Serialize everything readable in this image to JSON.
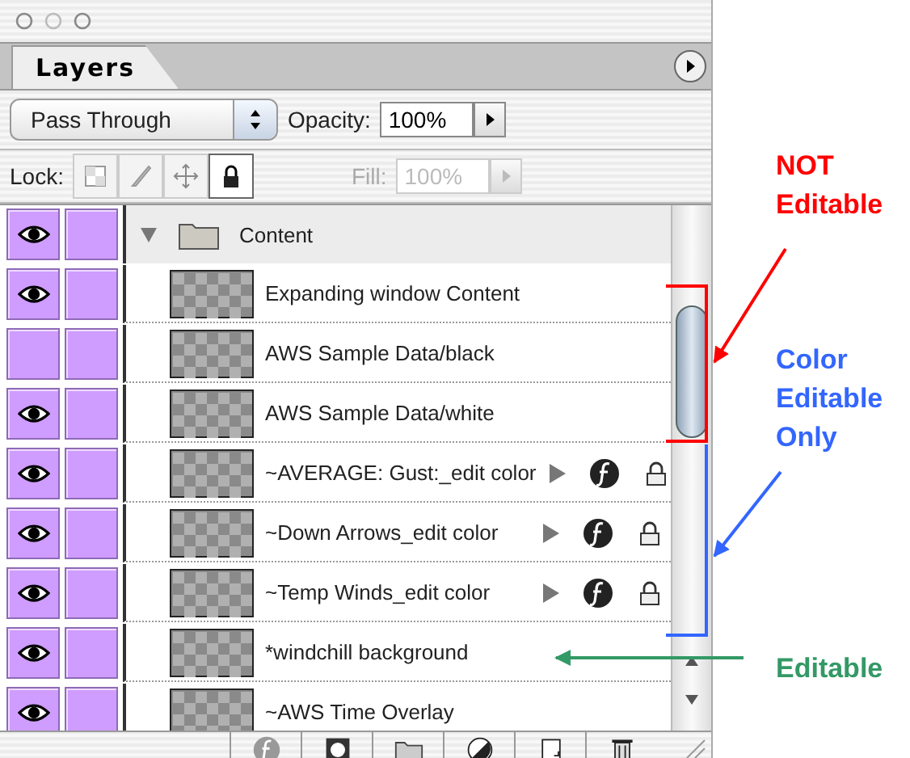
{
  "tabs": [
    {
      "label": "Layers",
      "selected": true
    }
  ],
  "blend_mode": {
    "value": "Pass Through"
  },
  "opacity": {
    "label": "Opacity:",
    "value": "100%"
  },
  "lock": {
    "label": "Lock:",
    "options": [
      {
        "kind": "transparency",
        "on": false
      },
      {
        "kind": "brush",
        "on": false
      },
      {
        "kind": "move",
        "on": false
      },
      {
        "kind": "all",
        "on": true
      }
    ]
  },
  "fill": {
    "label": "Fill:",
    "value": "100%",
    "disabled": true
  },
  "group": {
    "name": "Content",
    "expanded": true,
    "visible": true
  },
  "layers": [
    {
      "name": "Expanding window Content",
      "visible": true,
      "effects": false,
      "locked": false
    },
    {
      "name": "AWS Sample Data/black",
      "visible": false,
      "effects": false,
      "locked": false
    },
    {
      "name": "AWS Sample Data/white",
      "visible": true,
      "effects": false,
      "locked": false
    },
    {
      "name": "~AVERAGE: Gust:_edit color",
      "visible": true,
      "effects": true,
      "locked": true
    },
    {
      "name": "~Down Arrows_edit color",
      "visible": true,
      "effects": true,
      "locked": true
    },
    {
      "name": "~Temp Winds_edit color",
      "visible": true,
      "effects": true,
      "locked": true
    },
    {
      "name": "*windchill background",
      "visible": true,
      "effects": false,
      "locked": false
    },
    {
      "name": "~AWS Time Overlay",
      "visible": true,
      "effects": false,
      "locked": false
    }
  ],
  "annotations": [
    {
      "kind": "bracket",
      "text": "NOT Editable",
      "color": "#ff0000"
    },
    {
      "kind": "bracket",
      "text": "Color Editable Only",
      "color": "#3366ff"
    },
    {
      "kind": "pointer",
      "text": "Editable",
      "color": "#339966"
    }
  ]
}
